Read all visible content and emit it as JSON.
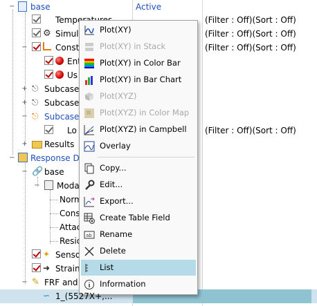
{
  "tree": {
    "status_header": "Active",
    "rows": [
      {
        "label": "base",
        "col2": "Active",
        "col3": ""
      },
      {
        "label": "Temperatures",
        "col2": "",
        "col3": "(Filter : Off)(Sort : Off)"
      },
      {
        "label": "Simula",
        "col2": "",
        "col3": "(Filter : Off)(Sort : Off)"
      },
      {
        "label": "Constr",
        "col2": "",
        "col3": "(Filter : Off)(Sort : Off)"
      },
      {
        "label": "Ent",
        "col2": "",
        "col3": ""
      },
      {
        "label": "Us",
        "col2": "",
        "col3": ""
      },
      {
        "label": "Subcase",
        "col2": "",
        "col3": ""
      },
      {
        "label": "Subcase",
        "col2": "",
        "col3": ""
      },
      {
        "label": "Subcase",
        "col2": "",
        "col3": ""
      },
      {
        "label": "Lo",
        "col2": "",
        "col3": "(Filter : Off)(Sort : Off)"
      },
      {
        "label": "Results",
        "col2": "",
        "col3": ""
      },
      {
        "label": "Response Dy",
        "col2": "",
        "col3": ""
      },
      {
        "label": "base",
        "col2": "",
        "col3": ""
      },
      {
        "label": "Moda",
        "col2": "",
        "col3": ""
      },
      {
        "label": "Norm",
        "col2": "",
        "col3": ""
      },
      {
        "label": "Cons",
        "col2": "",
        "col3": ""
      },
      {
        "label": "Attac",
        "col2": "",
        "col3": ""
      },
      {
        "label": "Resid",
        "col2": "",
        "col3": ""
      },
      {
        "label": "Senso",
        "col2": "",
        "col3": ""
      },
      {
        "label": "Strain",
        "col2": "",
        "col3": ""
      },
      {
        "label": "FRF and T",
        "col2": "",
        "col3": ""
      },
      {
        "label": "1_(5527X+,...",
        "col2": "",
        "col3": ""
      }
    ]
  },
  "menu": {
    "items": [
      {
        "label": "Plot(XY)",
        "icon": "plot-xy-icon",
        "enabled": true
      },
      {
        "label": "Plot(XY) in Stack",
        "icon": "plot-stack-icon",
        "enabled": false
      },
      {
        "label": "Plot(XY) in Color Bar",
        "icon": "color-bar-icon",
        "enabled": true
      },
      {
        "label": "Plot(XY) in Bar Chart",
        "icon": "bar-chart-icon",
        "enabled": true
      },
      {
        "label": "Plot(XYZ)",
        "icon": "plot-xyz-icon",
        "enabled": false
      },
      {
        "label": "Plot(XYZ) in Color Map",
        "icon": "color-map-icon",
        "enabled": false
      },
      {
        "label": "Plot(XYZ) in Campbell",
        "icon": "campbell-icon",
        "enabled": true
      },
      {
        "label": "Overlay",
        "icon": "overlay-icon",
        "enabled": true
      },
      {
        "label": "Copy...",
        "icon": "copy-icon",
        "enabled": true
      },
      {
        "label": "Edit...",
        "icon": "wrench-icon",
        "enabled": true
      },
      {
        "label": "Export...",
        "icon": "export-icon",
        "enabled": true
      },
      {
        "label": "Create Table Field",
        "icon": "table-field-icon",
        "enabled": true
      },
      {
        "label": "Rename",
        "icon": "rename-icon",
        "enabled": true
      },
      {
        "label": "Delete",
        "icon": "delete-icon",
        "enabled": true
      },
      {
        "label": "List",
        "icon": "list-icon",
        "enabled": true,
        "highlighted": true
      },
      {
        "label": "Information",
        "icon": "info-icon",
        "enabled": true
      }
    ]
  }
}
